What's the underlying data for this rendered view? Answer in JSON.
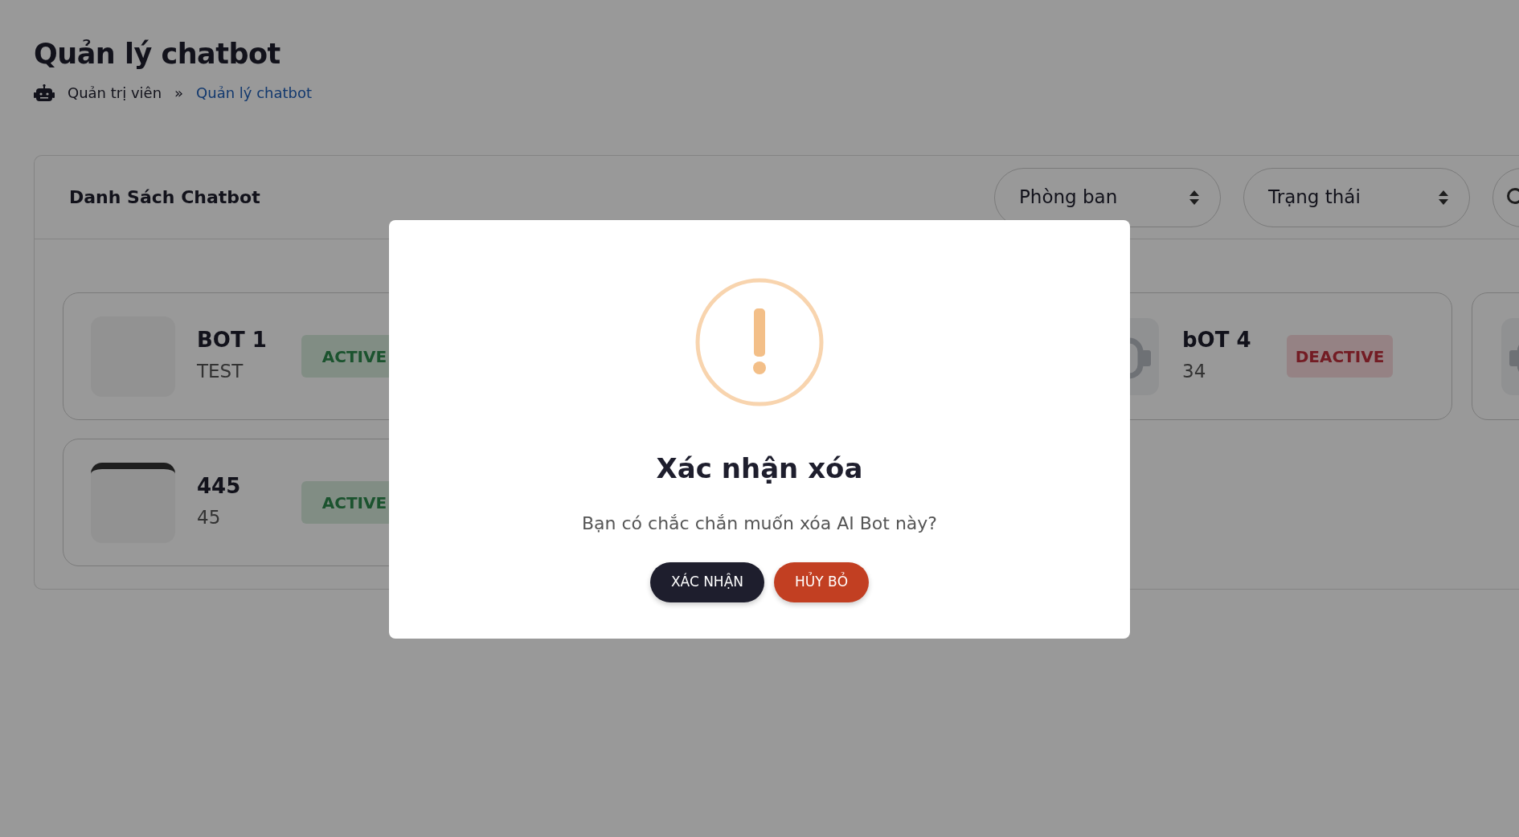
{
  "page_title": "Quản lý chatbot",
  "breadcrumb": [
    {
      "label": "Quản trị viên",
      "current": false
    },
    {
      "label": "Quản lý chatbot",
      "current": true
    }
  ],
  "breadcrumb_separator": "»",
  "panel": {
    "title": "Danh Sách Chatbot",
    "filters": [
      {
        "label": "Phòng ban"
      },
      {
        "label": "Trạng thái"
      }
    ],
    "card_rows": [
      [
        {
          "kind": "screenshot",
          "name": "BOT 1",
          "description": "TEST",
          "status": {
            "label": "ACTIVE",
            "kind": "active"
          }
        },
        {
          "kind": "robot",
          "name": "bOT 4",
          "description": "34",
          "status": {
            "label": "DEACTIVE",
            "kind": "deactive"
          }
        },
        {
          "kind": "robot"
        }
      ],
      [
        {
          "kind": "screenshot",
          "name": "445",
          "description": "45",
          "status": {
            "label": "ACTIVE",
            "kind": "active"
          }
        }
      ]
    ]
  },
  "dialog": {
    "title": "Xác nhận xóa",
    "message": "Bạn có chắc chắn muốn xóa AI Bot này?",
    "buttons": [
      {
        "label": "XÁC NHẬN",
        "kind": "confirm"
      },
      {
        "label": "HỦY BỎ",
        "kind": "cancel"
      }
    ]
  }
}
